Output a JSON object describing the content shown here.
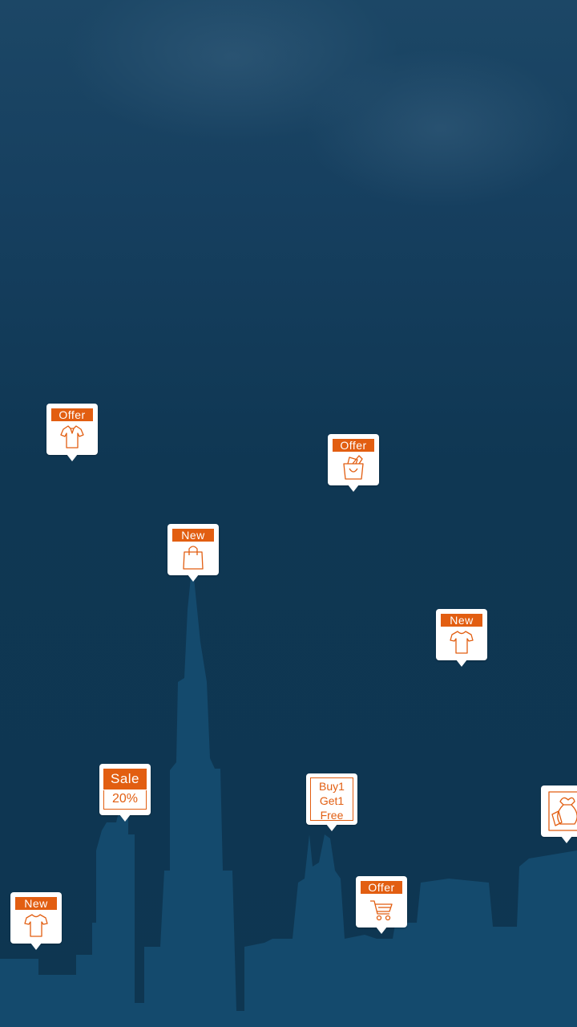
{
  "pins": {
    "offer_shirt": {
      "label": "Offer",
      "icon": "polo-shirt-icon"
    },
    "offer_bag": {
      "label": "Offer",
      "icon": "gift-bag-icon"
    },
    "new_bag": {
      "label": "New",
      "icon": "shopping-bag-icon"
    },
    "new_shirt_right": {
      "label": "New",
      "icon": "tshirt-icon"
    },
    "sale": {
      "top": "Sale",
      "bottom": "20%"
    },
    "bogo": {
      "line1": "Buy1",
      "line2": "Get1",
      "line3": "Free"
    },
    "money": {
      "icon": "money-bag-icon"
    },
    "new_shirt_left": {
      "label": "New",
      "icon": "tshirt-icon"
    },
    "offer_cart": {
      "label": "Offer",
      "icon": "shopping-cart-icon"
    }
  },
  "colors": {
    "accent": "#e25e11",
    "background": "#0e3651",
    "skyline": "#144a6d"
  }
}
